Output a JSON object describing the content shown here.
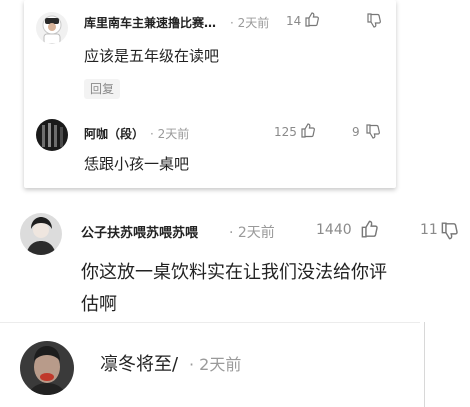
{
  "reply_card": {
    "comments": [
      {
        "name": "库里南车主兼速撸比赛…",
        "time": "· 2天前",
        "likes": "14",
        "text": "应该是五年级在读吧",
        "reply_label": "回复"
      },
      {
        "name": "阿咖（段）",
        "time": "· 2天前",
        "likes": "125",
        "dislikes": "9",
        "text": "恁跟小孩一桌吧"
      }
    ]
  },
  "main_comments": [
    {
      "name": "公子扶苏喂苏喂苏喂",
      "time": "· 2天前",
      "likes": "1440",
      "dislikes": "11",
      "text_line1": "你这放一桌饮料实在让我们没法给你评",
      "text_line2": "估啊"
    },
    {
      "name": "凛冬将至/",
      "time": "· 2天前"
    }
  ],
  "colors": {
    "text": "#222222",
    "meta": "#9a9a9a",
    "card_shadow": "rgba(0,0,0,0.22)"
  },
  "icons": [
    "thumb-up-icon",
    "thumb-down-icon"
  ]
}
